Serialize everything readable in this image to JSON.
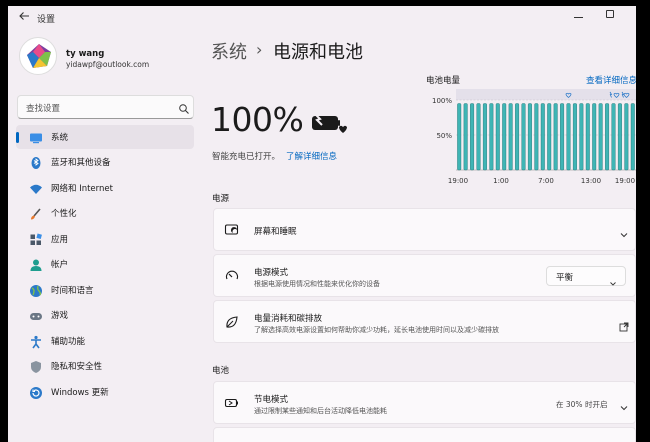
{
  "window": {
    "title": "设置"
  },
  "user": {
    "name": "ty wang",
    "email": "yidawpf@outlook.com"
  },
  "search": {
    "placeholder": "查找设置"
  },
  "sidebar": {
    "items": [
      {
        "label": "系统",
        "icon": "system-icon",
        "active": true
      },
      {
        "label": "蓝牙和其他设备",
        "icon": "bluetooth-icon"
      },
      {
        "label": "网络和 Internet",
        "icon": "wifi-icon"
      },
      {
        "label": "个性化",
        "icon": "brush-icon"
      },
      {
        "label": "应用",
        "icon": "apps-icon"
      },
      {
        "label": "帐户",
        "icon": "account-icon"
      },
      {
        "label": "时间和语言",
        "icon": "globe-icon"
      },
      {
        "label": "游戏",
        "icon": "gamepad-icon"
      },
      {
        "label": "辅助功能",
        "icon": "accessibility-icon"
      },
      {
        "label": "隐私和安全性",
        "icon": "shield-icon"
      },
      {
        "label": "Windows 更新",
        "icon": "update-icon"
      }
    ]
  },
  "header": {
    "root": "系统",
    "separator": "›",
    "page": "电源和电池"
  },
  "battery": {
    "percent": "100%",
    "status": "智能充电已打开。",
    "learn_more": "了解详细信息"
  },
  "chart": {
    "title": "电池电量",
    "details_link": "查看详细信息",
    "accent": "#3fb5b5"
  },
  "chart_data": {
    "type": "bar",
    "title": "电池电量",
    "y_ticks": [
      "100%",
      "50%"
    ],
    "x_ticks": [
      "19:00",
      "1:00",
      "7:00",
      "13:00",
      "19:00"
    ],
    "ylim": [
      0,
      100
    ],
    "values": [
      95,
      95,
      95,
      95,
      95,
      95,
      95,
      95,
      95,
      95,
      95,
      95,
      95,
      95,
      95,
      95,
      95,
      95,
      95,
      95,
      95,
      95,
      95,
      95,
      95,
      95,
      95,
      95
    ]
  },
  "sections": {
    "power": "电源",
    "battery": "电池"
  },
  "cards": {
    "screen_sleep": {
      "title": "屏幕和睡眠"
    },
    "power_mode": {
      "title": "电源模式",
      "subtitle": "根据电源使用情况和性能来优化你的设备",
      "value": "平衡"
    },
    "energy": {
      "title": "电量消耗和碳排放",
      "subtitle": "了解选择高效电源设置如何帮助你减少功耗，延长电池使用时间以及减少碳排放"
    },
    "saver": {
      "title": "节电模式",
      "subtitle": "通过限制某些通知和后台活动降低电池能耗",
      "right": "在 30% 时开启"
    }
  }
}
